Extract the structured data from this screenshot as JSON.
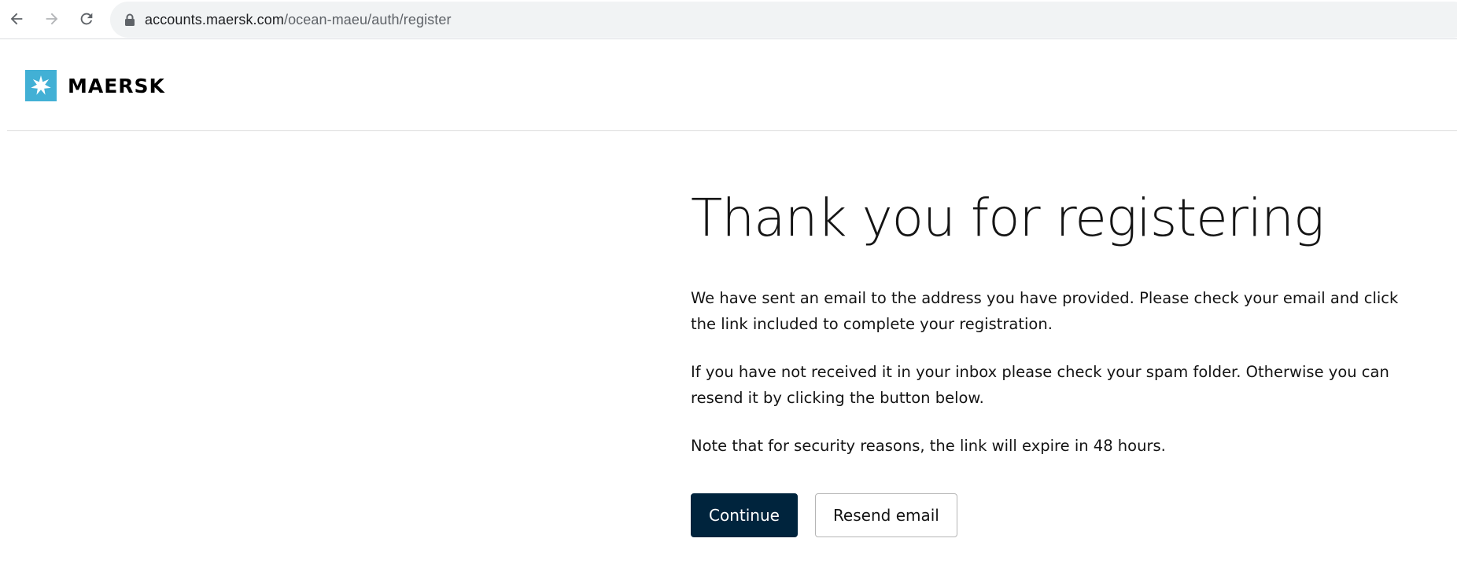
{
  "browser": {
    "url_host": "accounts.maersk.com",
    "url_path": "/ocean-maeu/auth/register",
    "icons": {
      "back": "arrow-left-icon",
      "forward": "arrow-right-icon",
      "reload": "reload-icon",
      "lock": "lock-icon"
    }
  },
  "header": {
    "brand_name": "MAERSK",
    "logo_icon": "seven-point-star-icon",
    "logo_color": "#42b0d5"
  },
  "main": {
    "title": "Thank you for registering",
    "paragraphs": [
      "We have sent an email to the address you have provided. Please check your email and click the link included to complete your registration.",
      "If you have not received it in your inbox please check your spam folder. Otherwise you can resend it by clicking the button below.",
      "Note that for security reasons, the link will expire in 48 hours."
    ],
    "continue_label": "Continue",
    "resend_label": "Resend email"
  },
  "colors": {
    "primary_button": "#00243d",
    "brand_accent": "#42b0d5"
  }
}
